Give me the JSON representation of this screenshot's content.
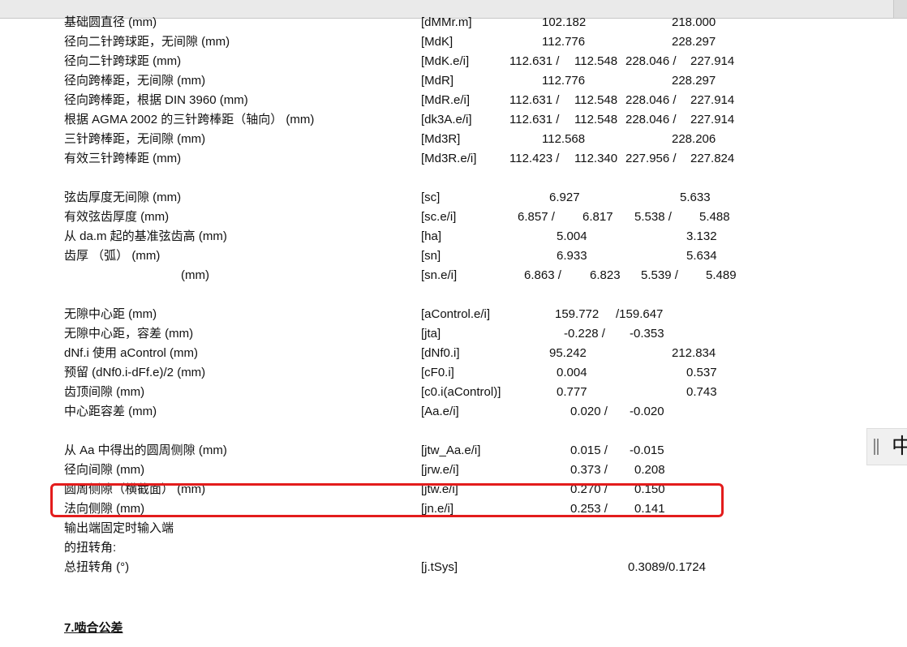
{
  "rows": [
    {
      "label": "基础圆直径 (mm)",
      "code": "[dMMr.m]",
      "v": [
        "102.182",
        "",
        "218.000"
      ]
    },
    {
      "label": "径向二针跨球距，无间隙 (mm)",
      "code": "[MdK]",
      "v": [
        "112.776",
        "",
        "228.297"
      ]
    },
    {
      "label": "径向二针跨球距 (mm)",
      "code": "[MdK.e/i]",
      "v": [
        "112.631 /",
        "112.548",
        "228.046 /",
        "227.914"
      ]
    },
    {
      "label": "径向跨棒距，无间隙 (mm)",
      "code": "[MdR]",
      "v": [
        "112.776",
        "",
        "228.297"
      ]
    },
    {
      "label": "径向跨棒距，根据 DIN 3960 (mm)",
      "code": "[MdR.e/i]",
      "v": [
        "112.631 /",
        "112.548",
        "228.046 /",
        "227.914"
      ]
    },
    {
      "label": "根据 AGMA 2002 的三针跨棒距（轴向） (mm)",
      "code": "[dk3A.e/i]",
      "v": [
        "112.631 /",
        "112.548",
        "228.046 /",
        "227.914"
      ]
    },
    {
      "label": "三针跨棒距，无间隙 (mm)",
      "code": "[Md3R]",
      "v": [
        "112.568",
        "",
        "228.206"
      ]
    },
    {
      "label": "有效三针跨棒距 (mm)",
      "code": "[Md3R.e/i]",
      "v": [
        "112.423 /",
        "112.340",
        "227.956 /",
        "227.824"
      ]
    },
    {
      "label": "弦齿厚度无间隙 (mm)",
      "code": "[sc]",
      "v": [
        "6.927",
        "",
        "5.633"
      ]
    },
    {
      "label": "有效弦齿厚度 (mm)",
      "code": "[sc.e/i]",
      "v": [
        "6.857 /",
        "6.817",
        "5.538 /",
        "5.488"
      ]
    },
    {
      "label": "从 da.m 起的基准弦齿高 (mm)",
      "code": "[ha]",
      "v": [
        "5.004",
        "",
        "3.132"
      ]
    },
    {
      "label": "齿厚 （弧） (mm)",
      "code": "[sn]",
      "v": [
        "6.933",
        "",
        "5.634"
      ]
    },
    {
      "label": "(mm)",
      "code": "[sn.e/i]",
      "v": [
        "6.863 /",
        "6.823",
        "5.539 /",
        "5.489"
      ]
    },
    {
      "label": "无隙中心距 (mm)",
      "code": "[aControl.e/i]",
      "v": [
        "159.772",
        "/159.647"
      ]
    },
    {
      "label": "无隙中心距，容差 (mm)",
      "code": "[jta]",
      "v": [
        "-0.228 /",
        "-0.353"
      ]
    },
    {
      "label": "dNf.i 使用 aControl (mm)",
      "code": "[dNf0.i]",
      "v": [
        "95.242",
        "",
        "212.834"
      ]
    },
    {
      "label": "预留 (dNf0.i-dFf.e)/2 (mm)",
      "code": "[cF0.i]",
      "v": [
        "0.004",
        "",
        "0.537"
      ]
    },
    {
      "label": "齿顶间隙 (mm)",
      "code": "[c0.i(aControl)]",
      "v": [
        "0.777",
        "",
        "0.743"
      ]
    },
    {
      "label": "中心距容差 (mm)",
      "code": "[Aa.e/i]",
      "v": [
        "0.020 /",
        "-0.020"
      ]
    },
    {
      "label": "从 Aa 中得出的圆周侧隙 (mm)",
      "code": "[jtw_Aa.e/i]",
      "v": [
        "0.015 /",
        "-0.015"
      ]
    },
    {
      "label": "径向间隙 (mm)",
      "code": "[jrw.e/i]",
      "v": [
        "0.373 /",
        "0.208"
      ]
    },
    {
      "label": "圆周侧隙（横截面） (mm)",
      "code": "[jtw.e/i]",
      "v": [
        "0.270 /",
        "0.150"
      ]
    },
    {
      "label": "法向侧隙 (mm)",
      "code": "[jn.e/i]",
      "v": [
        "0.253 /",
        "0.141"
      ]
    },
    {
      "label": "输出端固定时输入端",
      "code": "",
      "v": []
    },
    {
      "label": "的扭转角:",
      "code": "",
      "v": []
    },
    {
      "label": "总扭转角 (°)",
      "code": "[j.tSys]",
      "v": [
        "0.3089/0.1724"
      ]
    }
  ],
  "section_heading": "7.啮合公差",
  "ime_indicator": {
    "char": "中",
    "icon": "ime-handle-icon"
  },
  "highlight_color": "#e31c1c"
}
